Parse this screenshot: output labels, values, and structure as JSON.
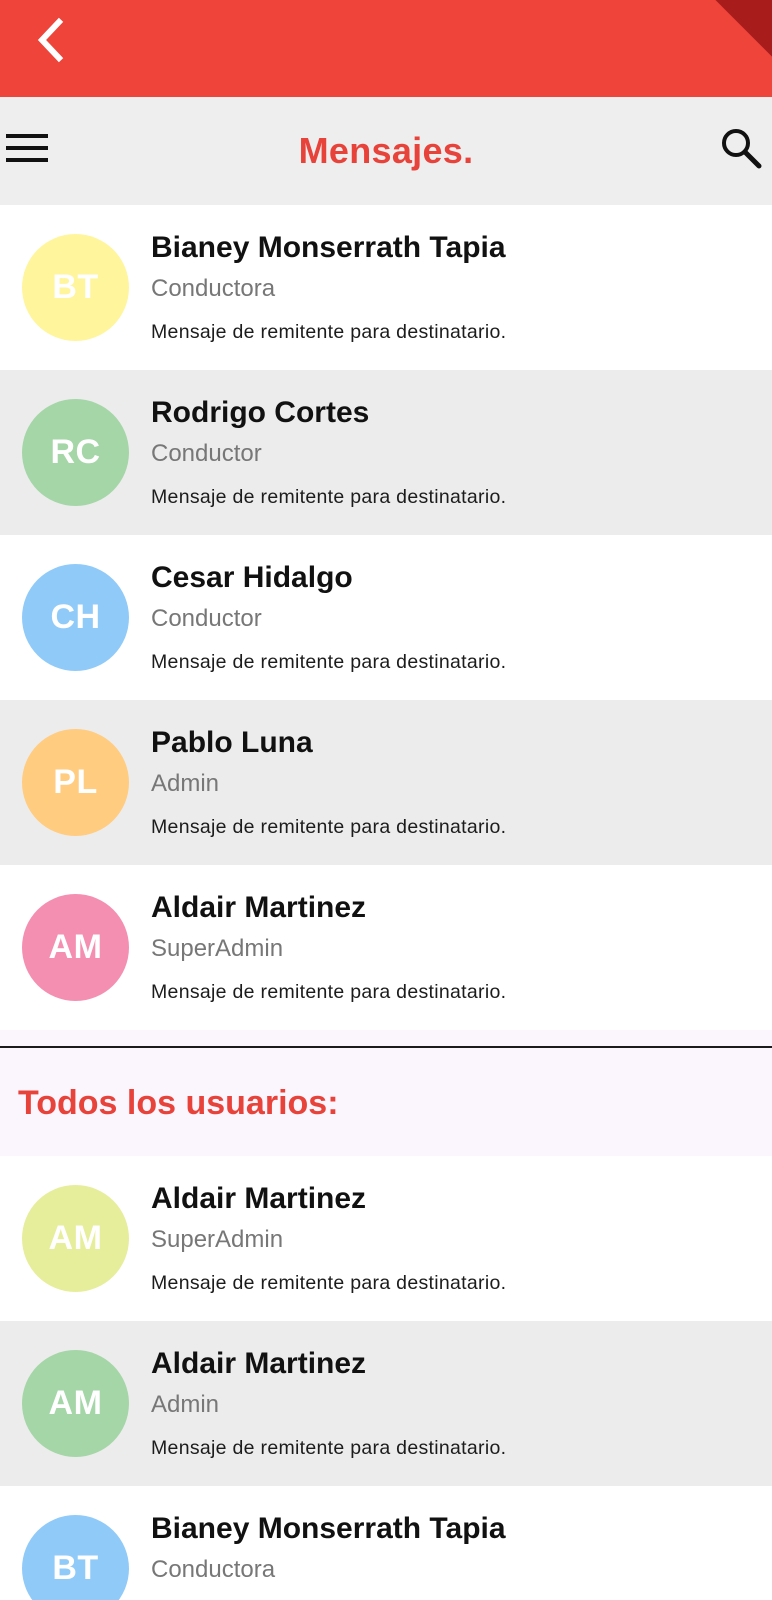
{
  "colors": {
    "appbar": "#ee443a",
    "accent_text": "#e8433a",
    "toolbar_bg": "#eeeeee",
    "row_alt_bg": "#ececec",
    "section_bg": "#fbf5fd"
  },
  "appbar": {
    "back_icon": "chevron-left-icon"
  },
  "toolbar": {
    "menu_icon": "hamburger-menu-icon",
    "title": "Mensajes.",
    "search_icon": "search-icon"
  },
  "recent": [
    {
      "initials": "BT",
      "color": "#fff59d",
      "name": "Bianey Monserrath Tapia",
      "role": "Conductora",
      "message": "Mensaje de remitente para destinatario."
    },
    {
      "initials": "RC",
      "color": "#a5d6a7",
      "name": "Rodrigo Cortes",
      "role": "Conductor",
      "message": "Mensaje de remitente para destinatario."
    },
    {
      "initials": "CH",
      "color": "#90caf9",
      "name": "Cesar Hidalgo",
      "role": "Conductor",
      "message": "Mensaje de remitente para destinatario."
    },
    {
      "initials": "PL",
      "color": "#ffcc80",
      "name": "Pablo Luna",
      "role": "Admin",
      "message": "Mensaje de remitente para destinatario."
    },
    {
      "initials": "AM",
      "color": "#f48fb1",
      "name": "Aldair Martinez",
      "role": "SuperAdmin",
      "message": "Mensaje de remitente para destinatario."
    }
  ],
  "all_users_section": {
    "title": "Todos los usuarios:"
  },
  "all_users": [
    {
      "initials": "AM",
      "color": "#e6ee9c",
      "name": "Aldair Martinez",
      "role": "SuperAdmin",
      "message": "Mensaje de remitente para destinatario."
    },
    {
      "initials": "AM",
      "color": "#a5d6a7",
      "name": "Aldair Martinez",
      "role": "Admin",
      "message": "Mensaje de remitente para destinatario."
    },
    {
      "initials": "BT",
      "color": "#90caf9",
      "name": "Bianey Monserrath Tapia",
      "role": "Conductora",
      "message": ""
    }
  ]
}
